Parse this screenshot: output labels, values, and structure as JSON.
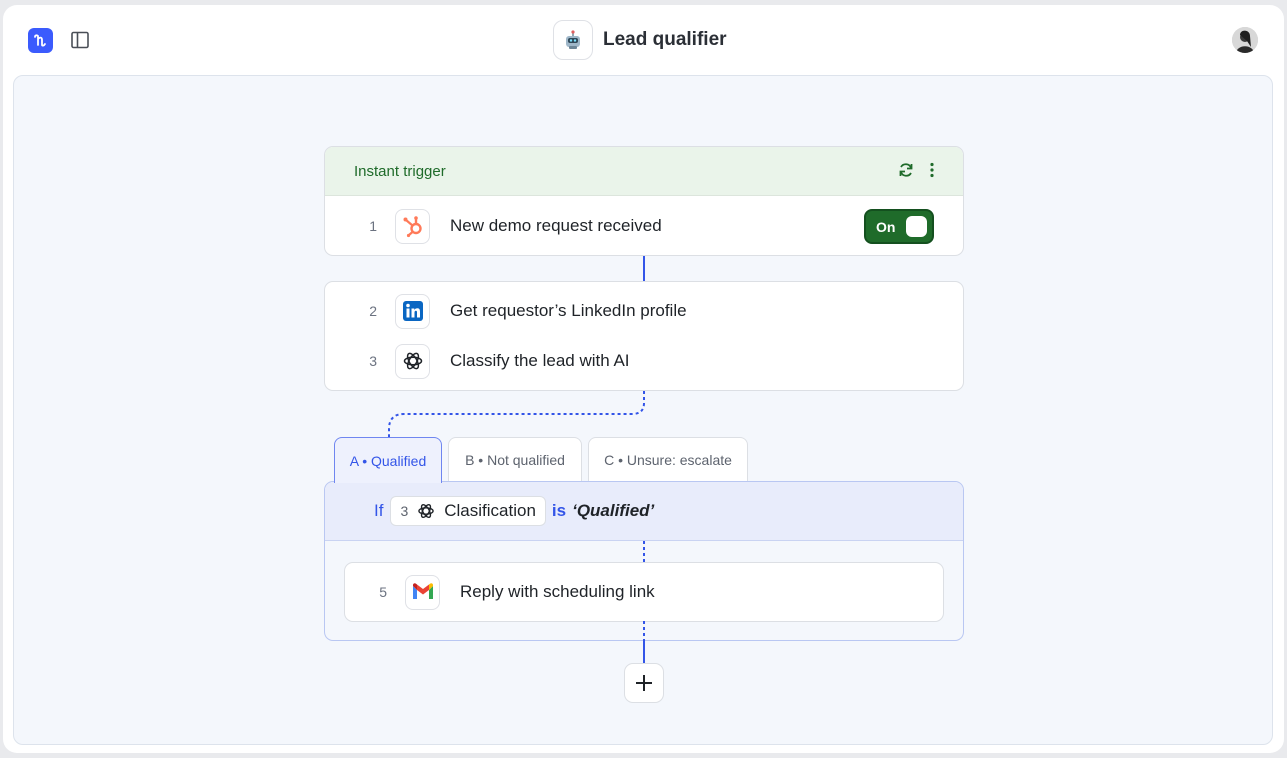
{
  "header": {
    "title": "Lead qualifier",
    "app_logo_icon": "workflow-logo-icon",
    "sidebar_toggle_icon": "sidebar-panel-icon",
    "title_icon": "robot-icon",
    "avatar_icon": "user-avatar"
  },
  "trigger": {
    "label": "Instant trigger",
    "refresh_icon": "refresh-icon",
    "more_icon": "more-vertical-icon",
    "step": {
      "number": "1",
      "icon": "hubspot-icon",
      "label": "New demo request received"
    },
    "toggle": {
      "label": "On",
      "enabled": true
    }
  },
  "actions": [
    {
      "number": "2",
      "icon": "linkedin-icon",
      "label": "Get requestor’s LinkedIn profile"
    },
    {
      "number": "3",
      "icon": "openai-icon",
      "label": "Classify the lead with AI"
    }
  ],
  "branches": {
    "tabs": [
      {
        "label": "A • Qualified",
        "active": true
      },
      {
        "label": "B • Not qualified",
        "active": false
      },
      {
        "label": "C • Unsure: escalate",
        "active": false
      }
    ],
    "condition": {
      "if_label": "If",
      "ref_number": "3",
      "ref_icon": "openai-icon",
      "ref_label": "Clasification",
      "operator": "is",
      "value": "‘Qualified’"
    },
    "step": {
      "number": "5",
      "icon": "gmail-icon",
      "label": "Reply with scheduling link"
    }
  },
  "add_button": {
    "icon": "plus-icon"
  },
  "colors": {
    "accent": "#3355e8",
    "trigger_green": "#1f6b2a",
    "canvas_bg": "#f4f7fc",
    "hubspot_orange": "#ff7a59",
    "linkedin_blue": "#0a66c2"
  }
}
